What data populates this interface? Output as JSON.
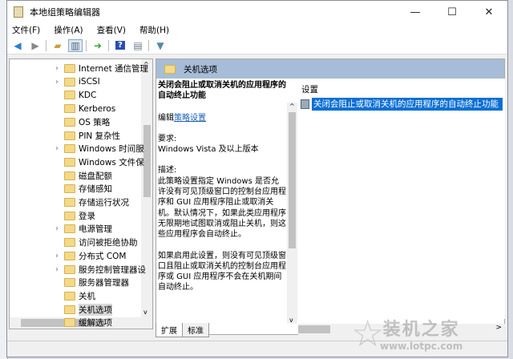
{
  "window": {
    "title": "本地组策略编辑器",
    "minimize": "—",
    "maximize": "☐",
    "close": "✕"
  },
  "menu": [
    "文件(F)",
    "操作(A)",
    "查看(V)",
    "帮助(H)"
  ],
  "toolbar": [
    "back-icon",
    "forward-icon",
    "up-folder-icon",
    "show-hide-tree-icon",
    "export-icon",
    "help-icon",
    "action-pane-icon",
    "filter-icon"
  ],
  "tree": {
    "items": [
      {
        "label": "Internet 通信管理",
        "expandable": true
      },
      {
        "label": "iSCSI",
        "expandable": true
      },
      {
        "label": "KDC",
        "expandable": false
      },
      {
        "label": "Kerberos",
        "expandable": false
      },
      {
        "label": "OS 策略",
        "expandable": false
      },
      {
        "label": "PIN 复杂性",
        "expandable": false
      },
      {
        "label": "Windows 时间服",
        "expandable": true
      },
      {
        "label": "Windows 文件保",
        "expandable": false
      },
      {
        "label": "磁盘配额",
        "expandable": false
      },
      {
        "label": "存储感知",
        "expandable": false
      },
      {
        "label": "存储运行状况",
        "expandable": false
      },
      {
        "label": "登录",
        "expandable": false
      },
      {
        "label": "电源管理",
        "expandable": true
      },
      {
        "label": "访问被拒绝协助",
        "expandable": false
      },
      {
        "label": "分布式 COM",
        "expandable": true
      },
      {
        "label": "服务控制管理器设",
        "expandable": true
      },
      {
        "label": "服务器管理器",
        "expandable": false
      },
      {
        "label": "关机",
        "expandable": false
      },
      {
        "label": "关机选项",
        "expandable": false,
        "selected": true
      },
      {
        "label": "缓解选项",
        "expandable": false
      }
    ]
  },
  "right": {
    "header": "关机选项",
    "desc": {
      "title": "关闭会阻止或取消关机的应用程序的自动终止功能",
      "edit_prefix": "编辑",
      "edit_link": "策略设置",
      "req_label": "要求:",
      "req_value": "Windows Vista 及以上版本",
      "desc_label": "描述:",
      "desc_p1": "此策略设置指定 Windows 是否允许没有可见顶级窗口的控制台应用程序和 GUI 应用程序阻止或取消关机。默认情况下，如果此类应用程序无限期地试图取消或阻止关机，则这些应用程序会自动终止。",
      "desc_p2": "如果启用此设置，则没有可见顶级窗口且阻止或取消关机的控制台应用程序或 GUI 应用程序不会在关机期间自动终止。"
    },
    "settings_header": "设置",
    "settings": [
      "关闭会阻止或取消关机的应用程序的自动终止功能"
    ]
  },
  "tabs": [
    "扩展",
    "标准"
  ],
  "watermark": {
    "name": "装机之家",
    "url": "www.lotpc.com"
  },
  "colors": {
    "header": "#a7bcd6",
    "selection": "#0a6fd4",
    "link": "#1a5fb4"
  }
}
